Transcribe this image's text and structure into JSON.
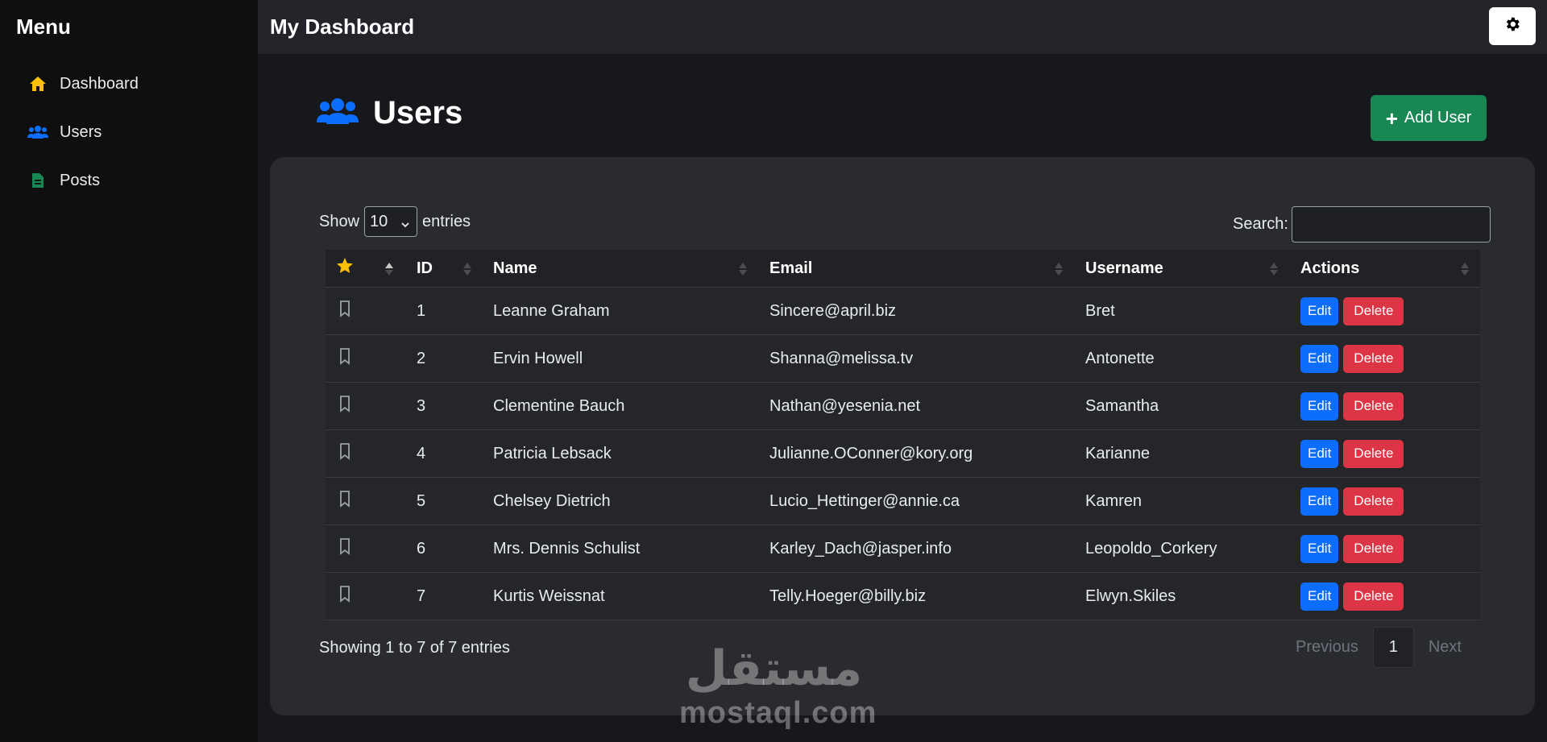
{
  "sidebar": {
    "title": "Menu",
    "items": [
      {
        "label": "Dashboard",
        "icon": "home-icon",
        "color": "#ffc107"
      },
      {
        "label": "Users",
        "icon": "users-icon",
        "color": "#0d6efd"
      },
      {
        "label": "Posts",
        "icon": "file-icon",
        "color": "#198754"
      }
    ]
  },
  "topbar": {
    "title": "My Dashboard",
    "settings_icon": "gear-icon"
  },
  "page": {
    "title": "Users",
    "add_label": "Add User"
  },
  "table_controls": {
    "show_label": "Show",
    "entries_value": "10",
    "entries_label": "entries",
    "search_label": "Search:",
    "search_value": ""
  },
  "table": {
    "headers": [
      "",
      "ID",
      "Name",
      "Email",
      "Username",
      "Actions"
    ],
    "rows": [
      {
        "id": "1",
        "name": "Leanne Graham",
        "email": "Sincere@april.biz",
        "username": "Bret"
      },
      {
        "id": "2",
        "name": "Ervin Howell",
        "email": "Shanna@melissa.tv",
        "username": "Antonette"
      },
      {
        "id": "3",
        "name": "Clementine Bauch",
        "email": "Nathan@yesenia.net",
        "username": "Samantha"
      },
      {
        "id": "4",
        "name": "Patricia Lebsack",
        "email": "Julianne.OConner@kory.org",
        "username": "Karianne"
      },
      {
        "id": "5",
        "name": "Chelsey Dietrich",
        "email": "Lucio_Hettinger@annie.ca",
        "username": "Kamren"
      },
      {
        "id": "6",
        "name": "Mrs. Dennis Schulist",
        "email": "Karley_Dach@jasper.info",
        "username": "Leopoldo_Corkery"
      },
      {
        "id": "7",
        "name": "Kurtis Weissnat",
        "email": "Telly.Hoeger@billy.biz",
        "username": "Elwyn.Skiles"
      }
    ],
    "edit_label": "Edit",
    "delete_label": "Delete"
  },
  "footer": {
    "info": "Showing 1 to 7 of 7 entries",
    "prev": "Previous",
    "page": "1",
    "next": "Next"
  },
  "watermark": {
    "arabic": "مستقل",
    "latin": "mostaql.com"
  },
  "colors": {
    "success": "#198754",
    "primary": "#0d6efd",
    "danger": "#dc3545",
    "warning": "#ffc107"
  }
}
